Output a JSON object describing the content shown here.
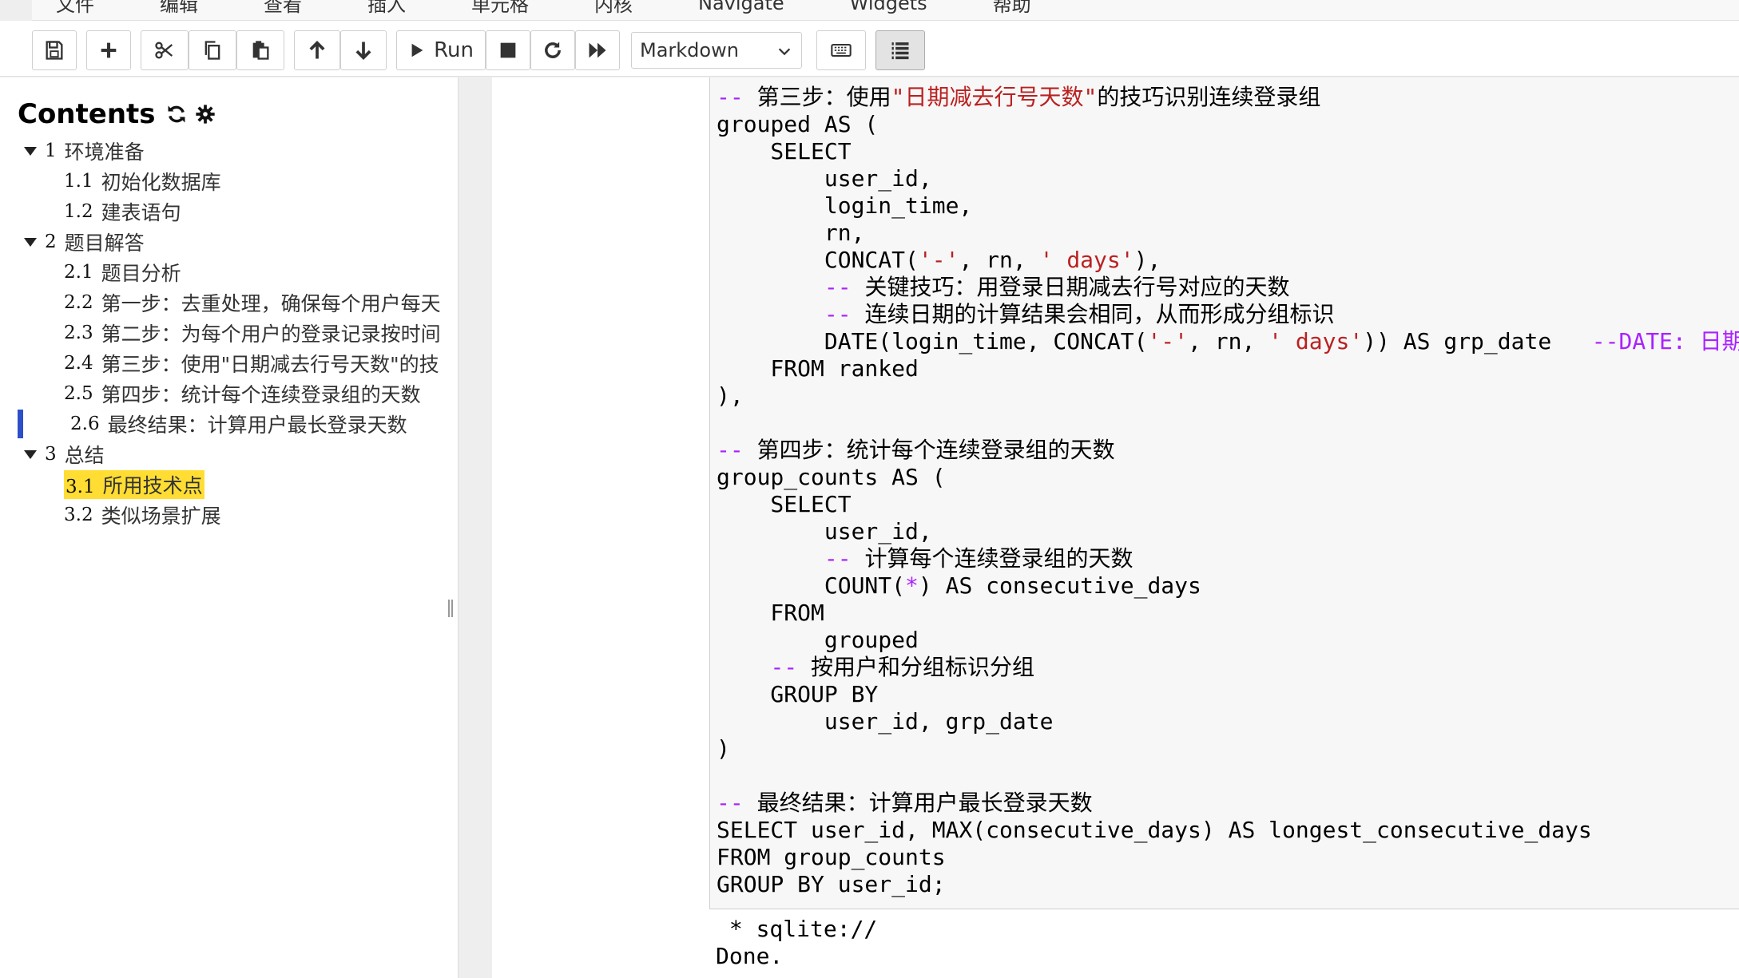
{
  "menu": [
    "文件",
    "编辑",
    "查看",
    "插入",
    "单元格",
    "内核",
    "Navigate",
    "Widgets",
    "帮助"
  ],
  "toolbar": {
    "run_label": "Run",
    "cell_type": "Markdown"
  },
  "toc": {
    "title": "Contents",
    "items": [
      {
        "num": "1",
        "label": "环境准备"
      },
      {
        "num": "1.1",
        "label": "初始化数据库"
      },
      {
        "num": "1.2",
        "label": "建表语句"
      },
      {
        "num": "2",
        "label": "题目解答"
      },
      {
        "num": "2.1",
        "label": "题目分析"
      },
      {
        "num": "2.2",
        "label": "第一步：去重处理，确保每个用户每天"
      },
      {
        "num": "2.3",
        "label": "第二步：为每个用户的登录记录按时间"
      },
      {
        "num": "2.4",
        "label": "第三步：使用\"日期减去行号天数\"的技"
      },
      {
        "num": "2.5",
        "label": "第四步：统计每个连续登录组的天数"
      },
      {
        "num": "2.6",
        "label": "最终结果：计算用户最长登录天数"
      },
      {
        "num": "3",
        "label": "总结"
      },
      {
        "num": "3.1",
        "label": "所用技术点"
      },
      {
        "num": "3.2",
        "label": "类似场景扩展"
      }
    ]
  },
  "code": {
    "l1_comment_a": "第三步：使用",
    "l1_string": "\"日期减去行号天数\"",
    "l1_comment_b": "的技巧识别连续登录组",
    "l2": "grouped AS (",
    "l3": "    SELECT",
    "l4": "        user_id,",
    "l5": "        login_time,",
    "l6": "        rn,",
    "l7_a": "        CONCAT(",
    "l7_s1": "'-'",
    "l7_b": ", rn, ",
    "l7_s2": "' days'",
    "l7_c": "),",
    "l8_comment": "关键技巧：用登录日期减去行号对应的天数",
    "l9_comment": "连续日期的计算结果会相同，从而形成分组标识",
    "l10_a": "        DATE(login_time, CONCAT(",
    "l10_s1": "'-'",
    "l10_b": ", rn, ",
    "l10_s2": "' days'",
    "l10_c": ")) AS grp_date   ",
    "l10_comment": "--DATE: 日期",
    "l11": "    FROM ranked",
    "l12": "),",
    "l14_comment": "第四步：统计每个连续登录组的天数",
    "l15": "group_counts AS (",
    "l16": "    SELECT",
    "l17": "        user_id,",
    "l18_comment": "计算每个连续登录组的天数",
    "l19_a": "        COUNT(",
    "l19_star": "*",
    "l19_b": ") AS consecutive_days",
    "l20": "    FROM",
    "l21": "        grouped",
    "l22_comment": "按用户和分组标识分组",
    "l23": "    GROUP BY",
    "l24": "        user_id, grp_date",
    "l25": ")",
    "l27_comment": "最终结果：计算用户最长登录天数",
    "l28": "SELECT user_id, MAX(consecutive_days) AS longest_consecutive_days",
    "l29": "FROM group_counts",
    "l30": "GROUP BY user_id;"
  },
  "output": {
    "line1": " * sqlite://",
    "line2": "Done."
  },
  "colors": {
    "keyword_purple": "#aa22ff",
    "string_red": "#ba2121",
    "highlight_yellow": "#ffdd33",
    "current_bar_blue": "#2d50c8"
  }
}
